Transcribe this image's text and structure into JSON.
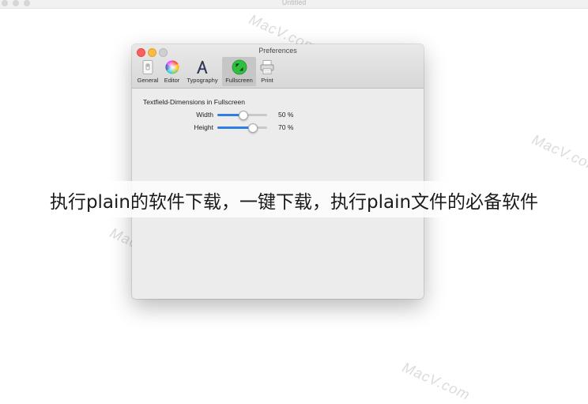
{
  "background_window": {
    "title": "Untitled"
  },
  "watermark_text": "MacV.com",
  "preferences": {
    "title": "Preferences",
    "toolbar": [
      {
        "label": "General",
        "icon": "switch-icon"
      },
      {
        "label": "Editor",
        "icon": "color-wheel-icon"
      },
      {
        "label": "Typography",
        "icon": "letter-a-icon"
      },
      {
        "label": "Fullscreen",
        "icon": "fullscreen-icon",
        "active": true
      },
      {
        "label": "Print",
        "icon": "printer-icon"
      }
    ],
    "section_title": "Textfield-Dimensions in Fullscreen",
    "rows": [
      {
        "label": "Width",
        "value": 50,
        "value_text": "50  %"
      },
      {
        "label": "Height",
        "value": 70,
        "value_text": "70  %"
      }
    ]
  },
  "caption": "执行plain的软件下载，一键下载，执行plain文件的必备软件",
  "colors": {
    "accent": "#2f7fe2",
    "close": "#fc605c",
    "minimize": "#fdbc40",
    "fullscreen_icon": "#2fbf3f"
  }
}
